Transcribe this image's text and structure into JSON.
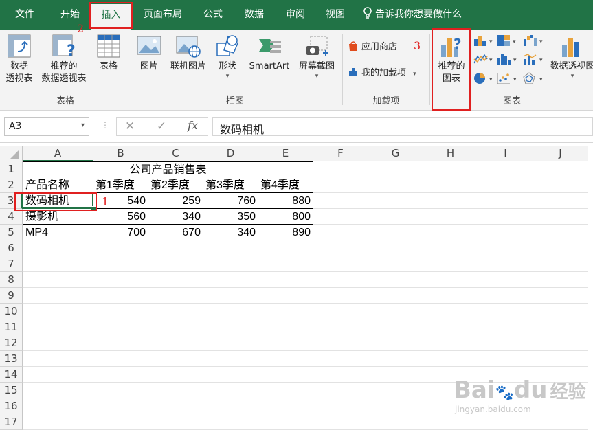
{
  "tabs": {
    "file": "文件",
    "home": "开始",
    "insert": "插入",
    "page_layout": "页面布局",
    "formulas": "公式",
    "data": "数据",
    "review": "审阅",
    "view": "视图",
    "tell_me": "告诉我你想要做什么",
    "active": "insert"
  },
  "ribbon": {
    "tables": {
      "label": "表格",
      "pivot": [
        "数据",
        "透视表"
      ],
      "recommended_pivot": [
        "推荐的",
        "数据透视表"
      ],
      "table": "表格"
    },
    "illustrations": {
      "label": "插图",
      "pictures": "图片",
      "online_pictures": "联机图片",
      "shapes": "形状",
      "smartart": "SmartArt",
      "screenshot": "屏幕截图"
    },
    "addins": {
      "label": "加载项",
      "store": "应用商店",
      "my_addins": "我的加载项"
    },
    "charts": {
      "label": "图表",
      "recommended": [
        "推荐的",
        "图表"
      ],
      "pivot_chart": "数据透视图"
    }
  },
  "annotations": {
    "step1": "1",
    "step2": "2",
    "step3": "3"
  },
  "formula_bar": {
    "name_box": "A3",
    "fx": "fx",
    "content": "数码相机"
  },
  "sheet": {
    "columns": [
      "A",
      "B",
      "C",
      "D",
      "E",
      "F",
      "G",
      "H",
      "I",
      "J"
    ],
    "rows": [
      "1",
      "2",
      "3",
      "4",
      "5",
      "6",
      "7",
      "8",
      "9",
      "10",
      "11",
      "12",
      "13",
      "14",
      "15",
      "16",
      "17"
    ],
    "title": "公司产品销售表",
    "headers": [
      "产品名称",
      "第1季度",
      "第2季度",
      "第3季度",
      "第4季度"
    ],
    "data": [
      [
        "数码相机",
        "540",
        "259",
        "760",
        "880"
      ],
      [
        "摄影机",
        "560",
        "340",
        "350",
        "800"
      ],
      [
        "MP4",
        "700",
        "670",
        "340",
        "890"
      ]
    ]
  },
  "watermark": {
    "brand": "Bai",
    "brand2": "du",
    "cn": "经验",
    "url": "jingyan.baidu.com"
  },
  "colors": {
    "excel_green": "#217346",
    "annotation_red": "#e02020"
  }
}
